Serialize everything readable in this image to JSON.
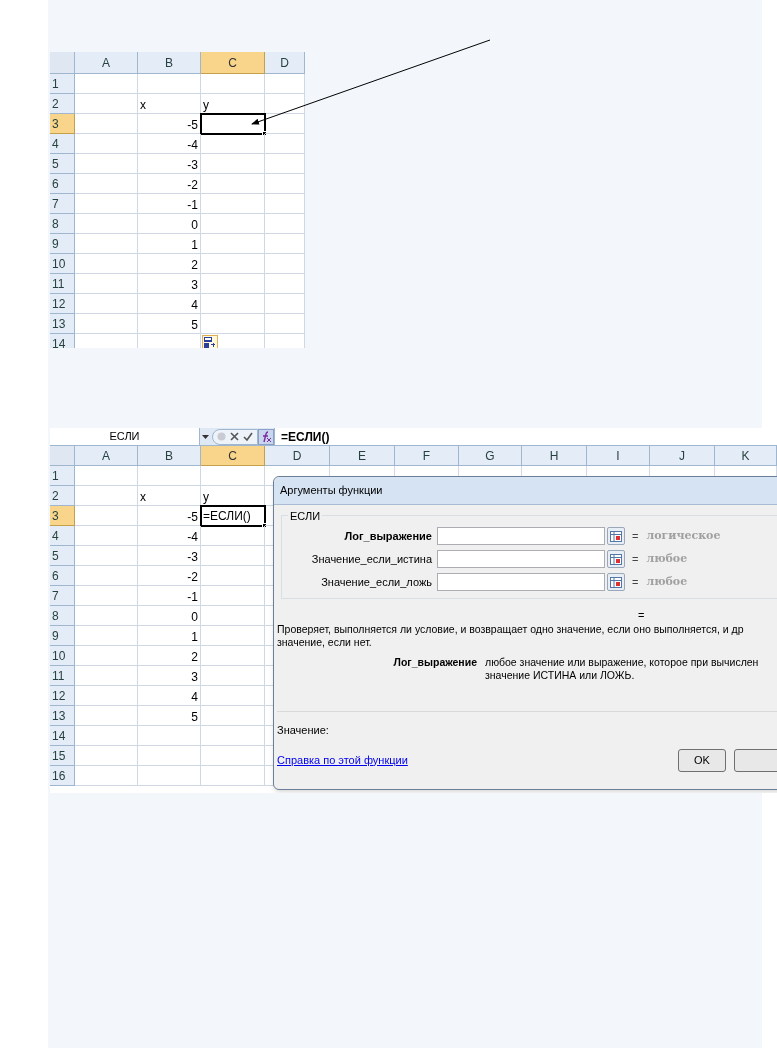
{
  "sheet_1": {
    "columns": [
      {
        "label": "A",
        "selected": false
      },
      {
        "label": "B",
        "selected": false
      },
      {
        "label": "C",
        "selected": true
      },
      {
        "label": "D",
        "selected": false
      }
    ],
    "rows": [
      {
        "number": "1",
        "selected": false,
        "cells": {}
      },
      {
        "number": "2",
        "selected": false,
        "cells": {
          "b": {
            "text": "x",
            "numeric": false
          },
          "c": {
            "text": "y",
            "numeric": false
          }
        }
      },
      {
        "number": "3",
        "selected": true,
        "cells": {
          "b": {
            "text": "-5",
            "numeric": true
          }
        },
        "active_c": true
      },
      {
        "number": "4",
        "selected": false,
        "cells": {
          "b": {
            "text": "-4",
            "numeric": true
          }
        }
      },
      {
        "number": "5",
        "selected": false,
        "cells": {
          "b": {
            "text": "-3",
            "numeric": true
          }
        }
      },
      {
        "number": "6",
        "selected": false,
        "cells": {
          "b": {
            "text": "-2",
            "numeric": true
          }
        }
      },
      {
        "number": "7",
        "selected": false,
        "cells": {
          "b": {
            "text": "-1",
            "numeric": true
          }
        }
      },
      {
        "number": "8",
        "selected": false,
        "cells": {
          "b": {
            "text": "0",
            "numeric": true
          }
        }
      },
      {
        "number": "9",
        "selected": false,
        "cells": {
          "b": {
            "text": "1",
            "numeric": true
          }
        }
      },
      {
        "number": "10",
        "selected": false,
        "cells": {
          "b": {
            "text": "2",
            "numeric": true
          }
        }
      },
      {
        "number": "11",
        "selected": false,
        "cells": {
          "b": {
            "text": "3",
            "numeric": true
          }
        }
      },
      {
        "number": "12",
        "selected": false,
        "cells": {
          "b": {
            "text": "4",
            "numeric": true
          }
        }
      },
      {
        "number": "13",
        "selected": false,
        "cells": {
          "b": {
            "text": "5",
            "numeric": true
          }
        }
      },
      {
        "number": "14",
        "selected": false,
        "cells": {},
        "paste_options_c": true
      }
    ]
  },
  "sheet_2": {
    "name_box": "ЕСЛИ",
    "formula": "=ЕСЛИ()",
    "columns": [
      {
        "label": "A",
        "selected": false
      },
      {
        "label": "B",
        "selected": false
      },
      {
        "label": "C",
        "selected": true
      },
      {
        "label": "D",
        "selected": false
      },
      {
        "label": "E",
        "selected": false
      },
      {
        "label": "F",
        "selected": false
      },
      {
        "label": "G",
        "selected": false
      },
      {
        "label": "H",
        "selected": false
      },
      {
        "label": "I",
        "selected": false
      },
      {
        "label": "J",
        "selected": false
      },
      {
        "label": "K",
        "selected": false
      }
    ],
    "rows": [
      {
        "number": "1",
        "selected": false,
        "cells": {}
      },
      {
        "number": "2",
        "selected": false,
        "cells": {
          "b": {
            "text": "x",
            "numeric": false
          },
          "c": {
            "text": "y",
            "numeric": false
          }
        }
      },
      {
        "number": "3",
        "selected": true,
        "cells": {
          "b": {
            "text": "-5",
            "numeric": true
          },
          "c": {
            "text": "=ЕСЛИ()",
            "numeric": false
          }
        },
        "active_c": true
      },
      {
        "number": "4",
        "selected": false,
        "cells": {
          "b": {
            "text": "-4",
            "numeric": true
          }
        }
      },
      {
        "number": "5",
        "selected": false,
        "cells": {
          "b": {
            "text": "-3",
            "numeric": true
          }
        }
      },
      {
        "number": "6",
        "selected": false,
        "cells": {
          "b": {
            "text": "-2",
            "numeric": true
          }
        }
      },
      {
        "number": "7",
        "selected": false,
        "cells": {
          "b": {
            "text": "-1",
            "numeric": true
          }
        }
      },
      {
        "number": "8",
        "selected": false,
        "cells": {
          "b": {
            "text": "0",
            "numeric": true
          }
        }
      },
      {
        "number": "9",
        "selected": false,
        "cells": {
          "b": {
            "text": "1",
            "numeric": true
          }
        }
      },
      {
        "number": "10",
        "selected": false,
        "cells": {
          "b": {
            "text": "2",
            "numeric": true
          }
        }
      },
      {
        "number": "11",
        "selected": false,
        "cells": {
          "b": {
            "text": "3",
            "numeric": true
          }
        }
      },
      {
        "number": "12",
        "selected": false,
        "cells": {
          "b": {
            "text": "4",
            "numeric": true
          }
        }
      },
      {
        "number": "13",
        "selected": false,
        "cells": {
          "b": {
            "text": "5",
            "numeric": true
          }
        }
      },
      {
        "number": "14",
        "selected": false,
        "cells": {}
      },
      {
        "number": "15",
        "selected": false,
        "cells": {}
      },
      {
        "number": "16",
        "selected": false,
        "cells": {}
      }
    ],
    "dialog": {
      "title": "Аргументы функции",
      "function": "ЕСЛИ",
      "arguments": [
        {
          "label": "Лог_выражение",
          "bold": true,
          "sign": "=",
          "hint": "логическое"
        },
        {
          "label": "Значение_если_истина",
          "bold": false,
          "sign": "=",
          "hint": "любое"
        },
        {
          "label": "Значение_если_ложь",
          "bold": false,
          "sign": "=",
          "hint": "любое"
        }
      ],
      "result_sign": "=",
      "description": [
        "Проверяет, выполняется ли условие, и возвращает одно значение, если оно выполняется, и др",
        "значение, если нет."
      ],
      "argument_help": {
        "name": "Лог_выражение",
        "lines": [
          "любое значение или выражение, которое при вычислен",
          "значение ИСТИНА или ЛОЖЬ."
        ]
      },
      "value_label": "Значение:",
      "help_link": "Справка по этой функции",
      "ok_button": "OK"
    }
  }
}
